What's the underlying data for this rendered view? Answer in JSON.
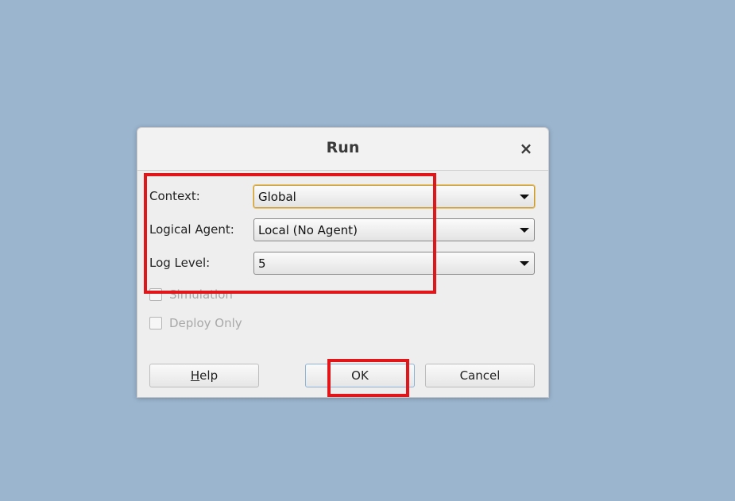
{
  "dialog": {
    "title": "Run",
    "close_glyph": "×"
  },
  "fields": [
    {
      "label": "Context:",
      "value": "Global",
      "focused": true
    },
    {
      "label": "Logical Agent:",
      "value": "Local (No Agent)",
      "focused": false
    },
    {
      "label": "Log Level:",
      "value": "5",
      "focused": false
    }
  ],
  "checkboxes": [
    {
      "label": "Simulation",
      "checked": false,
      "enabled": false
    },
    {
      "label": "Deploy Only",
      "checked": false,
      "enabled": false
    }
  ],
  "buttons": {
    "help_mnemonic": "H",
    "help_rest": "elp",
    "ok": "OK",
    "cancel": "Cancel"
  },
  "colors": {
    "desktop_background": "#9bb5cf",
    "annotation_red": "#e0161b",
    "focus_border": "#c79a3a"
  }
}
